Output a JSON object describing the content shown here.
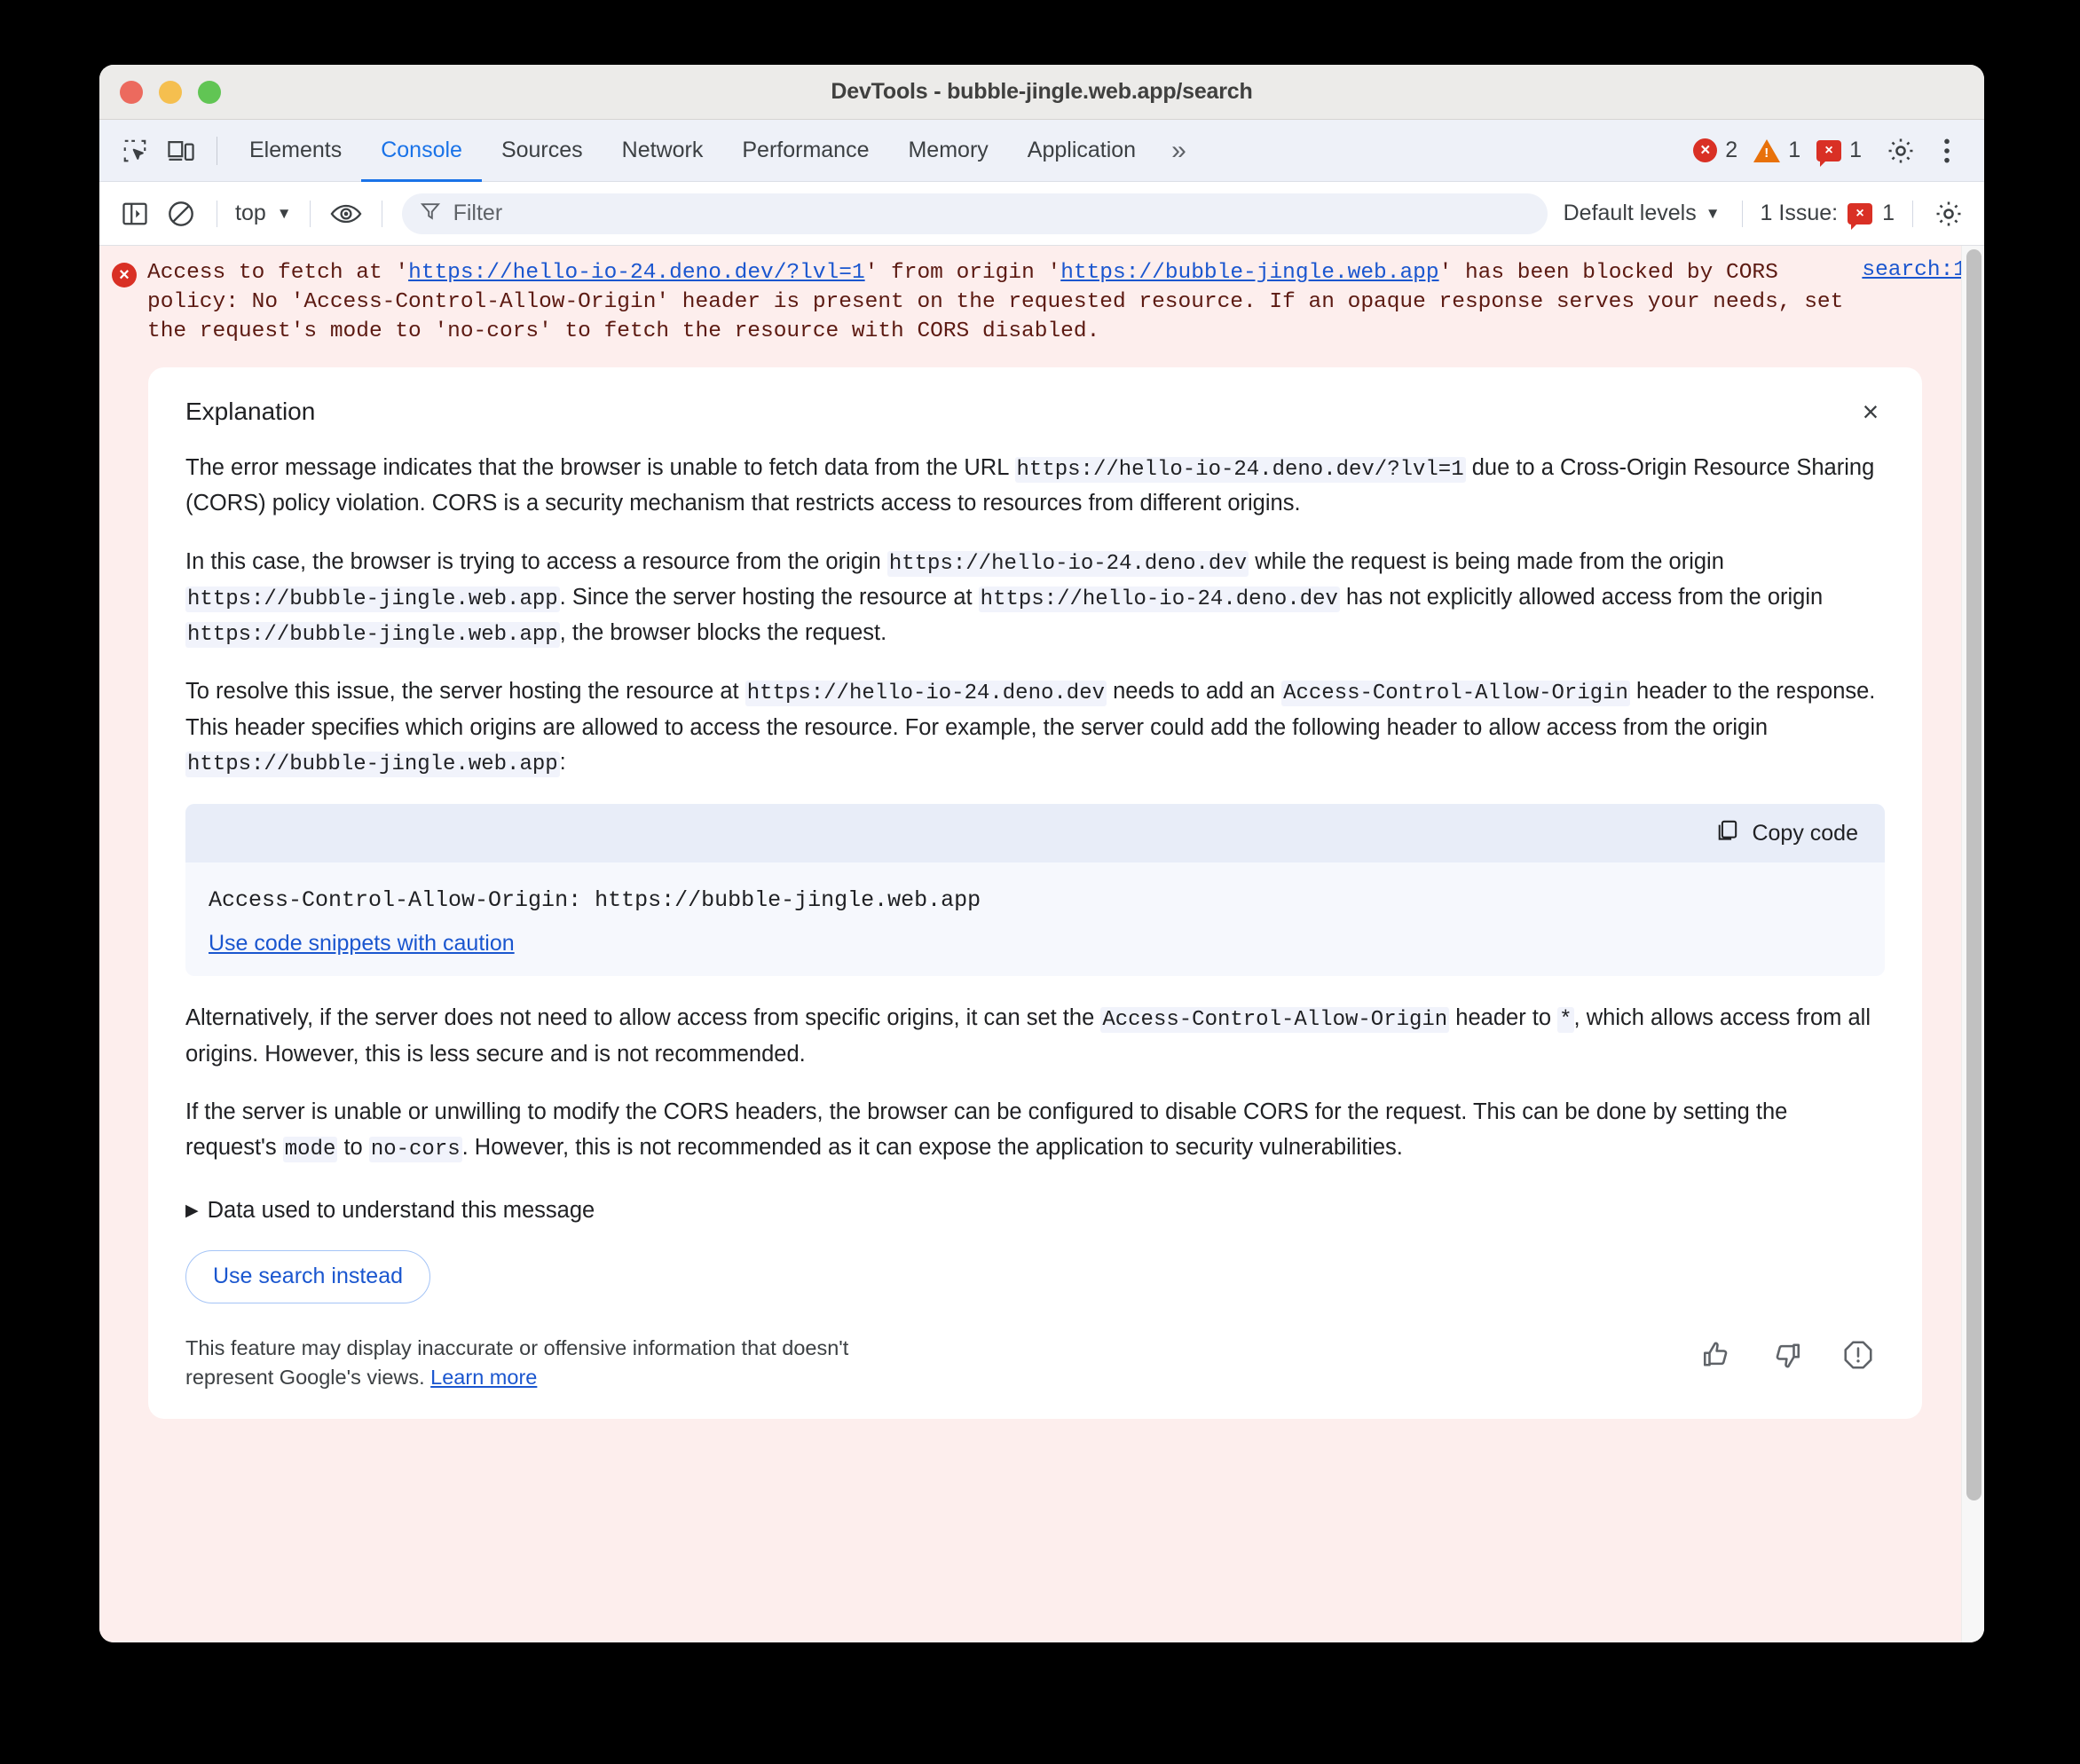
{
  "window": {
    "title": "DevTools - bubble-jingle.web.app/search",
    "traffic_lights": [
      "close",
      "minimize",
      "zoom"
    ]
  },
  "tabbar": {
    "inspect_icon": "inspect-element-icon",
    "device_icon": "device-toolbar-icon",
    "tabs": [
      {
        "label": "Elements",
        "active": false
      },
      {
        "label": "Console",
        "active": true
      },
      {
        "label": "Sources",
        "active": false
      },
      {
        "label": "Network",
        "active": false
      },
      {
        "label": "Performance",
        "active": false
      },
      {
        "label": "Memory",
        "active": false
      },
      {
        "label": "Application",
        "active": false
      }
    ],
    "more_label": "»",
    "error_count": "2",
    "warning_count": "1",
    "issue_count": "1",
    "issue_badge_glyph": "×",
    "settings_icon": "gear-icon",
    "menu_icon": "kebab-menu-icon"
  },
  "filterbar": {
    "sidebar_toggle_icon": "show-console-sidebar-icon",
    "clear_icon": "clear-console-icon",
    "context": "top",
    "eye_icon": "live-expression-icon",
    "filter_icon": "filter-funnel-icon",
    "filter_value": "",
    "filter_placeholder": "Filter",
    "levels_label": "Default levels",
    "issues_label": "1 Issue:",
    "issues_count": "1",
    "settings_icon": "console-settings-gear-icon"
  },
  "console": {
    "error_icon": "error-circle-icon",
    "message_parts": [
      {
        "t": "text",
        "v": "Access to fetch at '"
      },
      {
        "t": "link",
        "v": "https://hello-io-24.deno.dev/?lvl=1"
      },
      {
        "t": "text",
        "v": "' from origin '"
      },
      {
        "t": "link",
        "v": "https://bubble-jingle.web.app"
      },
      {
        "t": "text",
        "v": "' has been blocked by CORS policy: No 'Access-Control-Allow-Origin' header is present on the requested resource. If an opaque response serves your needs, set the request's mode to 'no-cors' to fetch the resource with CORS disabled."
      }
    ],
    "source_link": "search:1"
  },
  "explanation": {
    "title": "Explanation",
    "close_label": "×",
    "paragraphs": [
      [
        {
          "t": "text",
          "v": "The error message indicates that the browser is unable to fetch data from the URL "
        },
        {
          "t": "code",
          "v": "https://hello-io-24.deno.dev/?lvl=1"
        },
        {
          "t": "text",
          "v": " due to a Cross-Origin Resource Sharing (CORS) policy violation. CORS is a security mechanism that restricts access to resources from different origins."
        }
      ],
      [
        {
          "t": "text",
          "v": "In this case, the browser is trying to access a resource from the origin "
        },
        {
          "t": "code",
          "v": "https://hello-io-24.deno.dev"
        },
        {
          "t": "text",
          "v": " while the request is being made from the origin "
        },
        {
          "t": "code",
          "v": "https://bubble-jingle.web.app"
        },
        {
          "t": "text",
          "v": ". Since the server hosting the resource at "
        },
        {
          "t": "code",
          "v": "https://hello-io-24.deno.dev"
        },
        {
          "t": "text",
          "v": " has not explicitly allowed access from the origin "
        },
        {
          "t": "code",
          "v": "https://bubble-jingle.web.app"
        },
        {
          "t": "text",
          "v": ", the browser blocks the request."
        }
      ],
      [
        {
          "t": "text",
          "v": "To resolve this issue, the server hosting the resource at "
        },
        {
          "t": "code",
          "v": "https://hello-io-24.deno.dev"
        },
        {
          "t": "text",
          "v": " needs to add an "
        },
        {
          "t": "code",
          "v": "Access-Control-Allow-Origin"
        },
        {
          "t": "text",
          "v": " header to the response. This header specifies which origins are allowed to access the resource. For example, the server could add the following header to allow access from the origin "
        },
        {
          "t": "code",
          "v": "https://bubble-jingle.web.app"
        },
        {
          "t": "text",
          "v": ":"
        }
      ]
    ],
    "code_block": {
      "copy_icon": "copy-icon",
      "copy_label": "Copy code",
      "code": "Access-Control-Allow-Origin: https://bubble-jingle.web.app",
      "caution_link": "Use code snippets with caution"
    },
    "paragraphs_after": [
      [
        {
          "t": "text",
          "v": "Alternatively, if the server does not need to allow access from specific origins, it can set the "
        },
        {
          "t": "code",
          "v": "Access-Control-Allow-Origin"
        },
        {
          "t": "text",
          "v": " header to "
        },
        {
          "t": "code",
          "v": "*"
        },
        {
          "t": "text",
          "v": ", which allows access from all origins. However, this is less secure and is not recommended."
        }
      ],
      [
        {
          "t": "text",
          "v": "If the server is unable or unwilling to modify the CORS headers, the browser can be configured to disable CORS for the request. This can be done by setting the request's "
        },
        {
          "t": "code",
          "v": "mode"
        },
        {
          "t": "text",
          "v": " to "
        },
        {
          "t": "code",
          "v": "no-cors"
        },
        {
          "t": "text",
          "v": ". However, this is not recommended as it can expose the application to security vulnerabilities."
        }
      ]
    ],
    "data_used_label": "Data used to understand this message",
    "data_used_triangle": "▶",
    "use_search_label": "Use search instead",
    "disclaimer_text": "This feature may display inaccurate or offensive information that doesn't represent Google's views. ",
    "disclaimer_link": "Learn more",
    "feedback": {
      "thumb_up_icon": "thumb-up-icon",
      "thumb_down_icon": "thumb-down-icon",
      "report_icon": "report-issue-icon"
    }
  },
  "colors": {
    "accent": "#1a73e8",
    "error": "#d93025",
    "warning": "#e8710a",
    "error_bg": "#fdeeed",
    "link": "#1a56cf"
  }
}
